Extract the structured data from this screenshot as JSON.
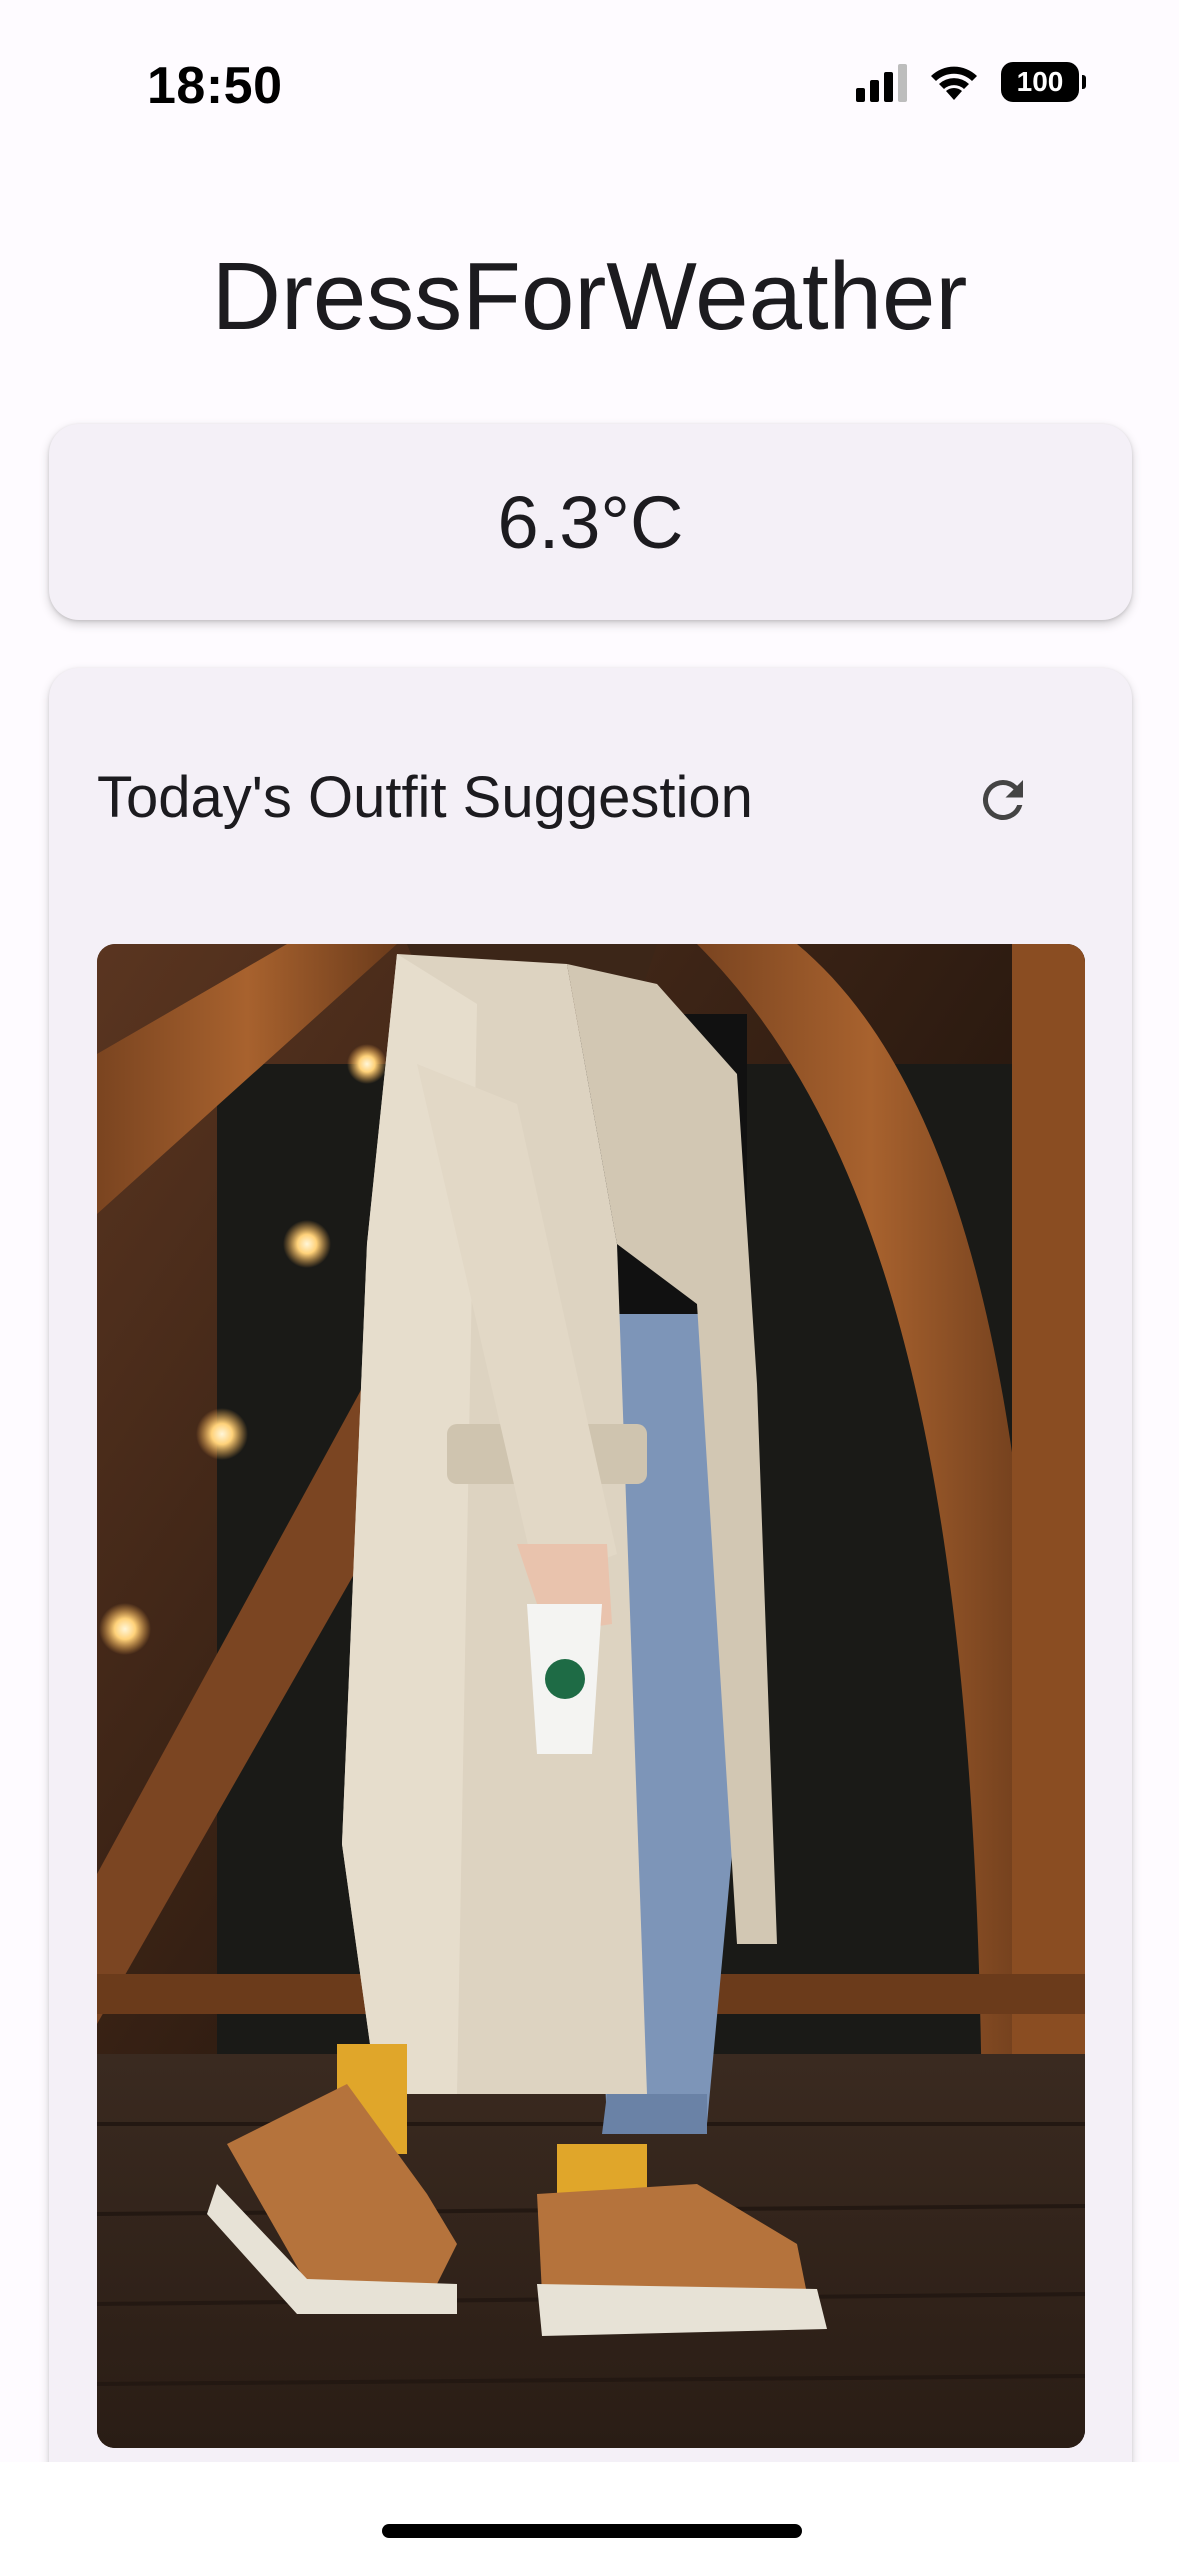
{
  "status_bar": {
    "time": "18:50",
    "battery": "100",
    "icons": [
      "cellular-signal-icon",
      "wifi-icon",
      "battery-icon"
    ]
  },
  "app": {
    "title": "DressForWeather"
  },
  "weather": {
    "temperature": "6.3°C"
  },
  "outfit": {
    "title": "Today's Outfit Suggestion",
    "refresh_icon": "refresh-icon",
    "image_alt": "Outfit photo"
  },
  "colors": {
    "background": "#fefbff",
    "card_surface": "#f4f0f7",
    "text": "#1c1b1f"
  }
}
